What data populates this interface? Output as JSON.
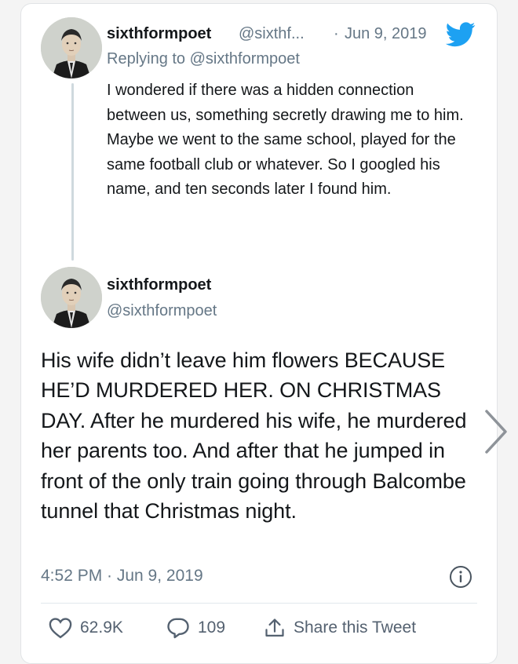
{
  "reply_tweet": {
    "display_name": "sixthformpoet",
    "handle": "@sixthf...",
    "separator": "·",
    "date": "Jun 9, 2019",
    "replying_to": "Replying to @sixthformpoet",
    "text": "I wondered if there was a hidden connection between us, something secretly drawing me to him. Maybe we went to the same school, played for the same football club or whatever. So I googled his name, and ten seconds later I found him."
  },
  "main_tweet": {
    "display_name": "sixthformpoet",
    "handle": "@sixthformpoet",
    "text": "His wife didn’t leave him flowers BECAUSE HE’D MURDERED HER. ON CHRISTMAS DAY. After he murdered his wife, he murdered her parents too. And after that he jumped in front of the only train going through Balcombe tunnel that Christmas night.",
    "timestamp": "4:52 PM · Jun 9, 2019"
  },
  "actions": {
    "likes": "62.9K",
    "replies": "109",
    "share_label": "Share this Tweet"
  },
  "colors": {
    "twitter_blue": "#1da1f2",
    "secondary_text": "#657786",
    "thread_line": "#cfd9de"
  },
  "icons": [
    "twitter-bird-icon",
    "info-icon",
    "heart-icon",
    "reply-bubble-icon",
    "share-icon",
    "chevron-right-icon"
  ]
}
